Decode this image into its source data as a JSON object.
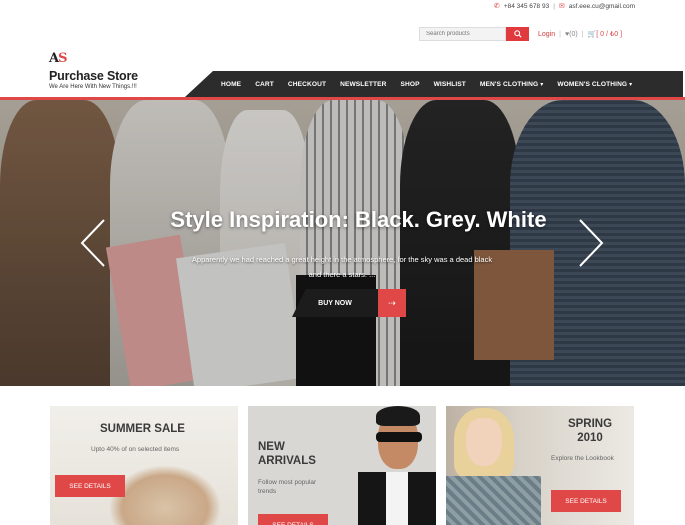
{
  "topbar": {
    "phone": "+84 345 678 93",
    "email": "asf.eee.cu@gmail.com"
  },
  "utility": {
    "search_placeholder": "Search products",
    "login_label": "Login",
    "wishlist_count": "(0)",
    "cart_summary": "[ 0 / ₺0 ]"
  },
  "brand": {
    "logo_a": "A",
    "logo_s": "S",
    "name": "Purchase Store",
    "tagline": "We Are Here With New Things.!!!"
  },
  "nav": {
    "items": [
      {
        "label": "HOME",
        "has_dropdown": false
      },
      {
        "label": "CART",
        "has_dropdown": false
      },
      {
        "label": "CHECKOUT",
        "has_dropdown": false
      },
      {
        "label": "NEWSLETTER",
        "has_dropdown": false
      },
      {
        "label": "SHOP",
        "has_dropdown": false
      },
      {
        "label": "WISHLIST",
        "has_dropdown": false
      },
      {
        "label": "MEN'S CLOTHING",
        "has_dropdown": true
      },
      {
        "label": "WOMEN'S CLOTHING",
        "has_dropdown": true
      }
    ],
    "caret": "▾"
  },
  "hero": {
    "title": "Style Inspiration: Black. Grey. White",
    "subtitle_line1": "Apparently we had reached a great height in the atmosphere, for the sky was a dead black",
    "subtitle_line2": "and there a stars. ...",
    "cta_label": "BUY NOW",
    "cta_arrow": "⇢"
  },
  "cards": [
    {
      "title_line1": "SUMMER SALE",
      "title_line2": "",
      "subtitle_line1": "Upto 40% of on selected items",
      "subtitle_line2": "",
      "button": "SEE DETAILS"
    },
    {
      "title_line1": "NEW",
      "title_line2": "ARRIVALS",
      "subtitle_line1": "Follow most popular",
      "subtitle_line2": "trends",
      "button": "SEE DETAILS"
    },
    {
      "title_line1": "SPRING",
      "title_line2": "2010",
      "subtitle_line1": "Explore the Lookbook",
      "subtitle_line2": "",
      "button": "SEE DETAILS"
    }
  ],
  "colors": {
    "accent": "#e04848",
    "nav_bg": "#2c2c2c"
  },
  "icons": {
    "phone": "phone-icon",
    "email": "envelope-icon",
    "search": "search-icon",
    "wishlist": "heart-icon",
    "cart": "cart-icon",
    "prev": "chevron-left-icon",
    "next": "chevron-right-icon"
  }
}
